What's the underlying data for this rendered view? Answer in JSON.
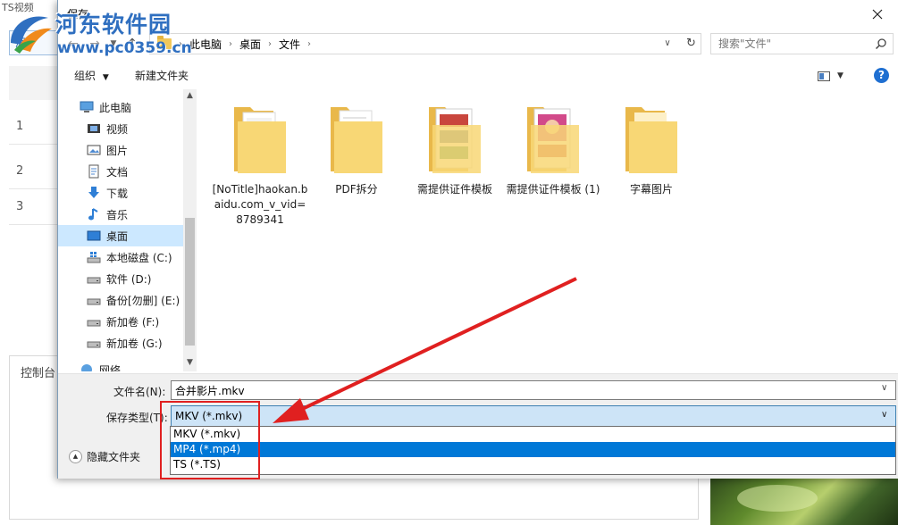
{
  "background_app": {
    "title_fragment": "TS视频",
    "add_button_fragment": "添",
    "rows": [
      "1",
      "2",
      "3"
    ],
    "console_label": "控制台"
  },
  "watermark": {
    "title": "河东软件园",
    "url": "www.pc0359.cn"
  },
  "dialog": {
    "title": "保存",
    "address_bar": {
      "breadcrumbs": [
        "此电脑",
        "桌面",
        "文件"
      ]
    },
    "search": {
      "placeholder": "搜索\"文件\""
    },
    "toolbar": {
      "organize_label": "组织",
      "new_folder_label": "新建文件夹",
      "help_label": "?"
    },
    "nav_pane": {
      "items": [
        {
          "label": "此电脑",
          "icon": "computer-icon"
        },
        {
          "label": "视频",
          "icon": "video-icon"
        },
        {
          "label": "图片",
          "icon": "pictures-icon"
        },
        {
          "label": "文档",
          "icon": "documents-icon"
        },
        {
          "label": "下载",
          "icon": "download-icon"
        },
        {
          "label": "音乐",
          "icon": "music-icon"
        },
        {
          "label": "桌面",
          "icon": "desktop-icon",
          "selected": true
        },
        {
          "label": "本地磁盘 (C:)",
          "icon": "windows-drive-icon"
        },
        {
          "label": "软件 (D:)",
          "icon": "drive-icon"
        },
        {
          "label": "备份[勿删] (E:)",
          "icon": "drive-icon"
        },
        {
          "label": "新加卷 (F:)",
          "icon": "drive-icon"
        },
        {
          "label": "新加卷 (G:)",
          "icon": "drive-icon"
        },
        {
          "label": "网络",
          "icon": "network-icon"
        }
      ]
    },
    "files": [
      {
        "label": "[NoTitle]haokan.baidu.com_v_vid=8789341",
        "icon": "folder-icon"
      },
      {
        "label": "PDF拆分",
        "icon": "folder-icon"
      },
      {
        "label": "需提供证件模板",
        "icon": "folder-icon"
      },
      {
        "label": "需提供证件模板 (1)",
        "icon": "folder-icon"
      },
      {
        "label": "字幕图片",
        "icon": "folder-icon"
      }
    ],
    "filename": {
      "label": "文件名(N):",
      "value": "合并影片.mkv"
    },
    "filetype": {
      "label": "保存类型(T):",
      "value": "MKV (*.mkv)",
      "options": [
        "MKV (*.mkv)",
        "MP4 (*.mp4)",
        "TS (*.TS)"
      ],
      "highlighted_index": 1
    },
    "hide_folders_label": "隐藏文件夹"
  },
  "colors": {
    "selection": "#cce8ff",
    "dropdown_highlight": "#0078d7",
    "annotation": "#e02020",
    "accent": "#1f6fd1"
  }
}
